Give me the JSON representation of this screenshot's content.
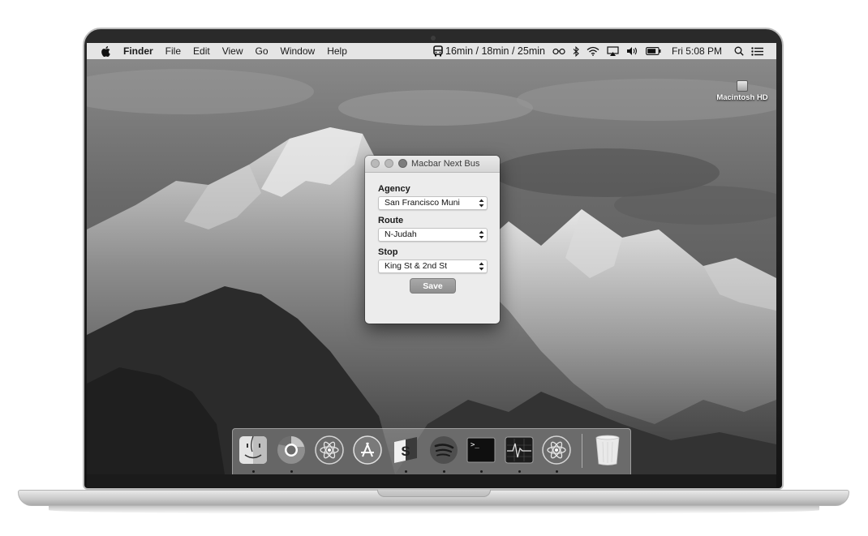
{
  "menubar": {
    "app_name": "Finder",
    "items": [
      "File",
      "Edit",
      "View",
      "Go",
      "Window",
      "Help"
    ],
    "bus_times": "16min / 18min / 25min",
    "clock": "Fri 5:08 PM"
  },
  "desktop": {
    "drive_label": "Macintosh HD"
  },
  "window": {
    "title": "Macbar Next Bus",
    "fields": [
      {
        "label": "Agency",
        "value": "San Francisco Muni"
      },
      {
        "label": "Route",
        "value": "N-Judah"
      },
      {
        "label": "Stop",
        "value": "King St & 2nd St"
      }
    ],
    "save_label": "Save"
  },
  "dock": {
    "apps": [
      {
        "name": "finder-icon",
        "running": true
      },
      {
        "name": "chrome-icon",
        "running": true
      },
      {
        "name": "atom-icon",
        "running": false
      },
      {
        "name": "app-store-icon",
        "running": false
      },
      {
        "name": "sublime-text-icon",
        "running": true
      },
      {
        "name": "spotify-icon",
        "running": true
      },
      {
        "name": "terminal-icon",
        "running": true
      },
      {
        "name": "activity-monitor-icon",
        "running": true
      },
      {
        "name": "atom-beta-icon",
        "running": true
      }
    ],
    "trash": "trash-icon"
  },
  "colors": {
    "menubar_bg": "#ececec",
    "window_bg": "#ececec",
    "save_button": "#9c9c9c"
  }
}
